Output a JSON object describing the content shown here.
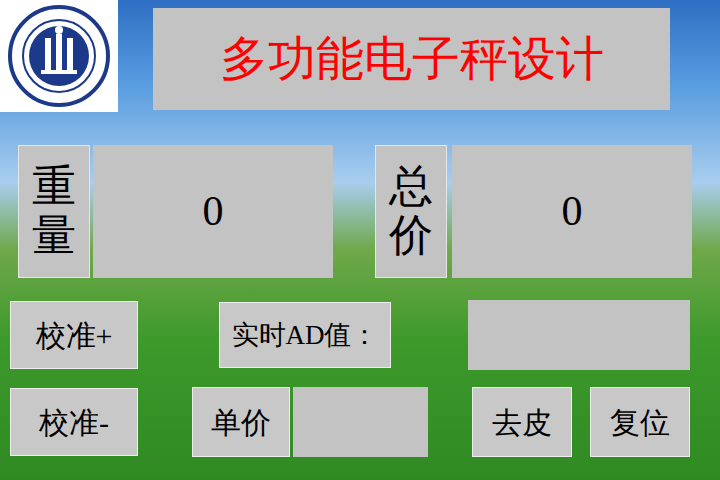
{
  "title": "多功能电子秤设计",
  "weight": {
    "label": "重量",
    "value": "0"
  },
  "total": {
    "label": "总价",
    "value": "0"
  },
  "calibrate_up": "校准+",
  "calibrate_down": "校准-",
  "ad": {
    "label": "实时AD值：",
    "value": ""
  },
  "unit_price": {
    "label": "单价",
    "value": ""
  },
  "tare": "去皮",
  "reset": "复位"
}
